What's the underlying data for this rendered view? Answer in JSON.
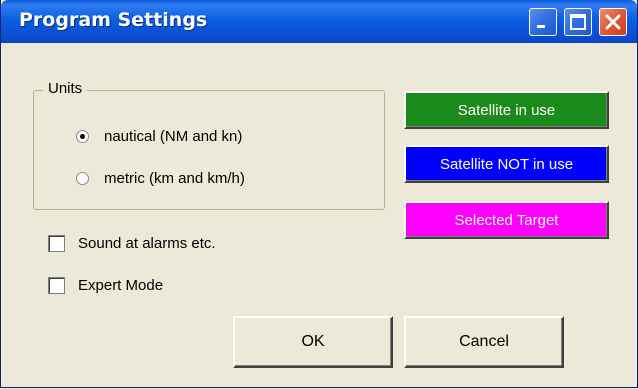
{
  "window": {
    "title": "Program Settings",
    "controls": [
      "minimize-icon",
      "maximize-icon",
      "close-icon"
    ]
  },
  "units": {
    "legend": "Units",
    "options": [
      {
        "label": "nautical (NM and kn)",
        "selected": true
      },
      {
        "label": "metric (km and km/h)",
        "selected": false
      }
    ]
  },
  "checkboxes": [
    {
      "label": "Sound at alarms etc.",
      "checked": false
    },
    {
      "label": "Expert Mode",
      "checked": false
    }
  ],
  "color_buttons": [
    {
      "label": "Satellite in use",
      "color": "#1a8a1a"
    },
    {
      "label": "Satellite NOT in use",
      "color": "#0000ff"
    },
    {
      "label": "Selected Target",
      "color": "#ff00ff"
    }
  ],
  "dialog_buttons": {
    "ok_label": "OK",
    "cancel_label": "Cancel"
  }
}
